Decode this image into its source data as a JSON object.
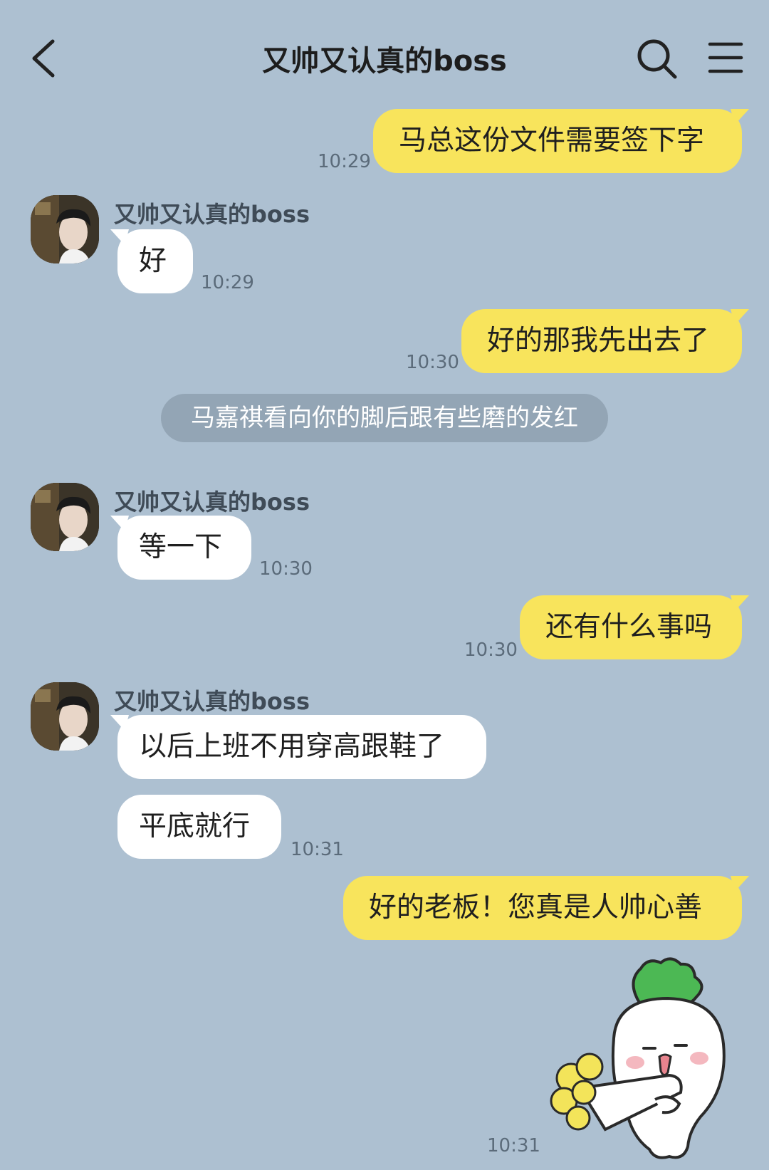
{
  "header": {
    "title": "又帅又认真的boss",
    "back_icon": "chevron-left-icon",
    "search_icon": "search-icon",
    "menu_icon": "menu-icon"
  },
  "colors": {
    "background": "#adc0d1",
    "my_bubble": "#f8e45c",
    "their_bubble": "#ffffff",
    "system_pill": "#93a5b5"
  },
  "messages": [
    {
      "from": "me",
      "text": "马总这份文件需要签下字",
      "time": "10:29"
    },
    {
      "from": "boss",
      "sender": "又帅又认真的boss",
      "text": "好",
      "time": "10:29"
    },
    {
      "from": "me",
      "text": "好的那我先出去了",
      "time": "10:30"
    },
    {
      "from": "system",
      "text": "马嘉祺看向你的脚后跟有些磨的发红"
    },
    {
      "from": "boss",
      "sender": "又帅又认真的boss",
      "text": "等一下",
      "time": "10:30"
    },
    {
      "from": "me",
      "text": "还有什么事吗",
      "time": "10:30"
    },
    {
      "from": "boss",
      "sender": "又帅又认真的boss",
      "text": "以后上班不用穿高跟鞋了"
    },
    {
      "from": "boss",
      "text": "平底就行",
      "time": "10:31"
    },
    {
      "from": "me",
      "text": "好的老板！您真是人帅心善"
    },
    {
      "from": "me",
      "sticker": "radish-holding-flowers-sticker",
      "time": "10:31"
    }
  ]
}
